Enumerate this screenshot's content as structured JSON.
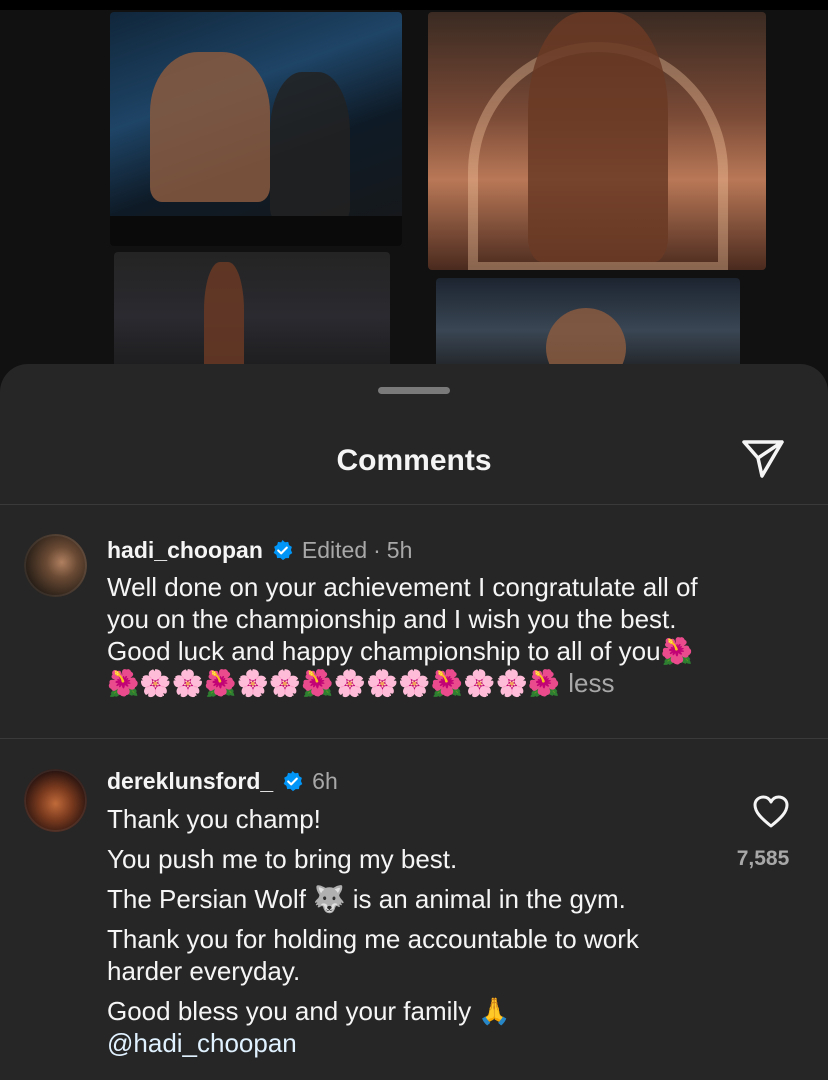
{
  "sheet": {
    "title": "Comments"
  },
  "comments": [
    {
      "username": "hadi_choopan",
      "verified": true,
      "edited_label": "Edited",
      "separator": "·",
      "time": "5h",
      "lines": [
        "Well done on your achievement  I congratulate all of",
        "you on the championship and I wish you the best.",
        "Good luck and happy championship to all of you🌺",
        "🌺🌸🌸🌺🌸🌸🌺🌸🌸🌸🌺🌸🌸🌺"
      ],
      "less_label": "less"
    },
    {
      "username": "dereklunsford_",
      "verified": true,
      "time": "6h",
      "paragraphs": [
        "Thank you champ!",
        "You push me to bring my best.",
        "The Persian Wolf 🐺 is an animal in the gym.",
        "Thank you for holding me accountable to work harder everyday.",
        "Good bless you and your family 🙏"
      ],
      "mention": "@hadi_choopan",
      "like_count": "7,585"
    }
  ],
  "icons": {
    "share": "paper-plane-icon",
    "verified": "verified-badge-icon",
    "like": "heart-outline-icon"
  },
  "colors": {
    "sheet_bg": "#262626",
    "verified": "#0095f6",
    "secondary_text": "#a8a8a8"
  }
}
